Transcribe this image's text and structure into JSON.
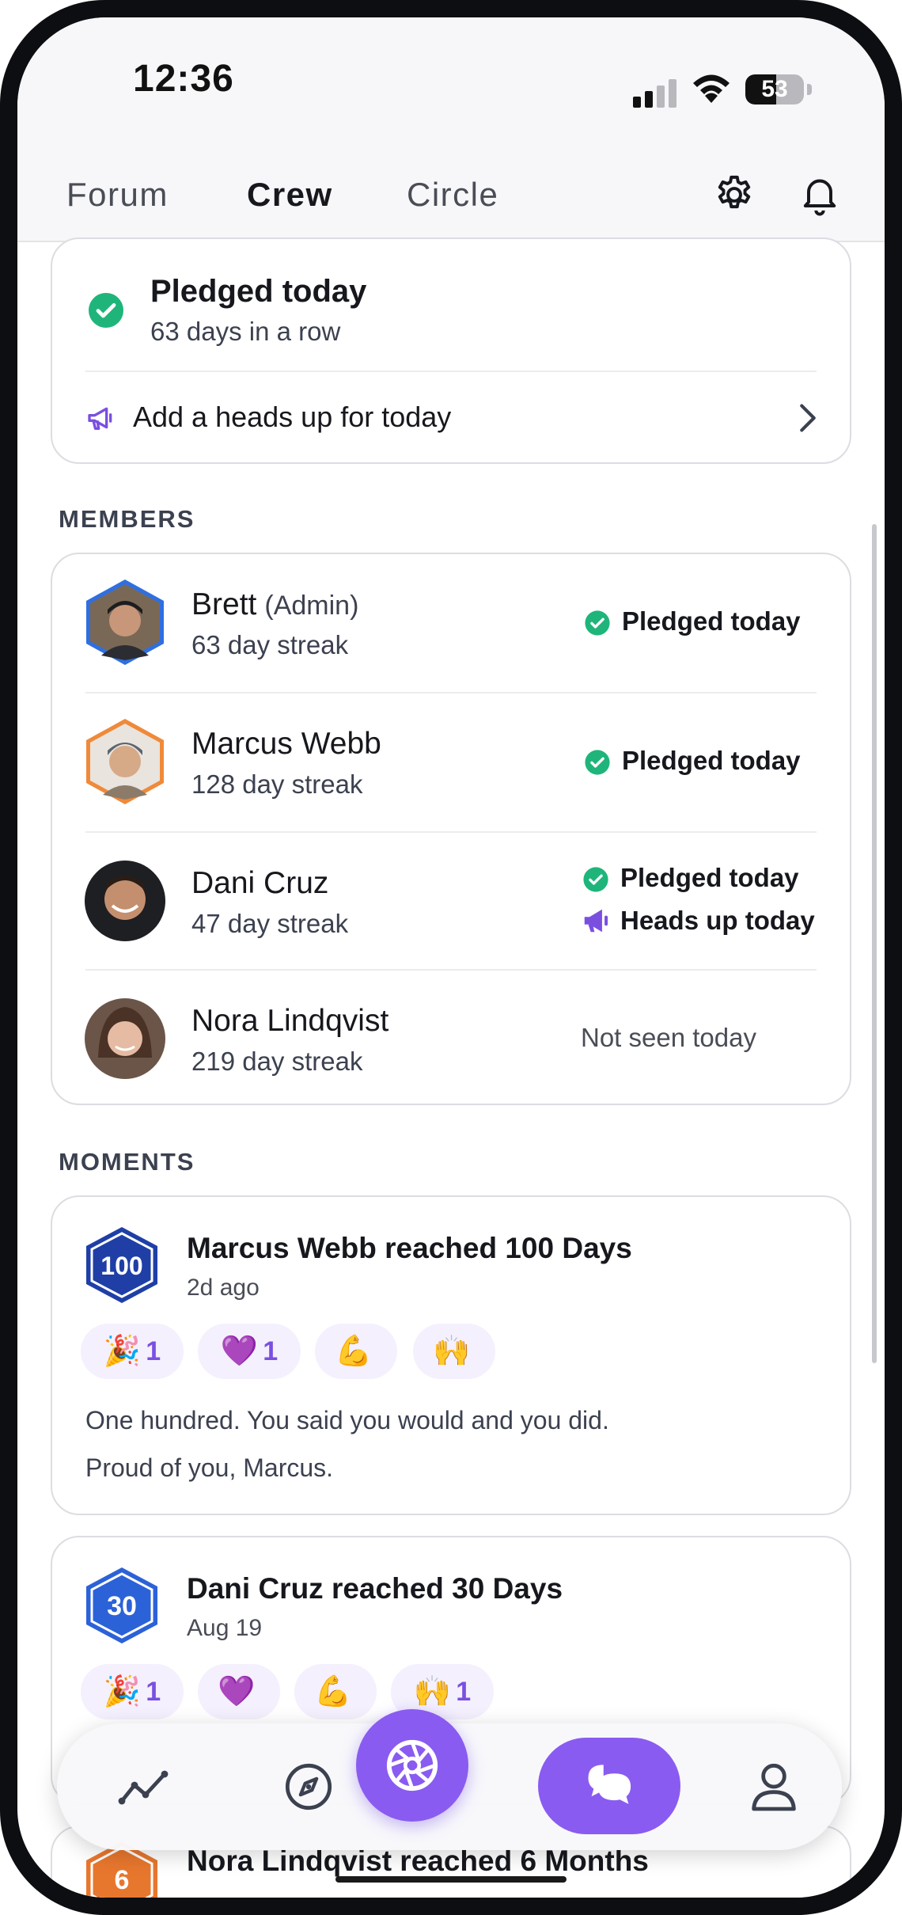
{
  "status_bar": {
    "time": "12:36",
    "battery": "53",
    "battery_level": 0.53
  },
  "tabs": [
    {
      "label": "Forum",
      "active": false
    },
    {
      "label": "Crew",
      "active": true
    },
    {
      "label": "Circle",
      "active": false
    }
  ],
  "pledge_card": {
    "title": "Pledged today",
    "subtitle": "63 days in a row",
    "heads_up_label": "Add a heads up for today"
  },
  "members_section": {
    "label": "MEMBERS",
    "members": [
      {
        "name": "Brett",
        "role": "(Admin)",
        "streak": "63 day streak",
        "status": [
          "Pledged today"
        ]
      },
      {
        "name": "Marcus Webb",
        "role": "",
        "streak": "128 day streak",
        "status": [
          "Pledged today"
        ]
      },
      {
        "name": "Dani Cruz",
        "role": "",
        "streak": "47 day streak",
        "status": [
          "Pledged today",
          "Heads up today"
        ]
      },
      {
        "name": "Nora Lindqvist",
        "role": "",
        "streak": "219 day streak",
        "status": [
          "Not seen today"
        ]
      }
    ]
  },
  "moments_section": {
    "label": "MOMENTS",
    "moments": [
      {
        "badge": "100",
        "badge_color": "#1f3fa6",
        "title": "Marcus Webb reached 100 Days",
        "time": "2d ago",
        "reactions": [
          {
            "emoji": "🎉",
            "count": "1"
          },
          {
            "emoji": "💜",
            "count": "1"
          },
          {
            "emoji": "💪",
            "count": ""
          },
          {
            "emoji": "🙌",
            "count": ""
          }
        ],
        "text": [
          "One hundred. You said you would and you did.",
          "Proud of you, Marcus."
        ]
      },
      {
        "badge": "30",
        "badge_color": "#2c62d8",
        "title": "Dani Cruz reached 30 Days",
        "time": "Aug 19",
        "reactions": [
          {
            "emoji": "🎉",
            "count": "1"
          },
          {
            "emoji": "💜",
            "count": ""
          },
          {
            "emoji": "💪",
            "count": ""
          },
          {
            "emoji": "🙌",
            "count": "1"
          }
        ],
        "text": []
      },
      {
        "badge": "6",
        "badge_color": "#e8772e",
        "title": "Nora Lindqvist reached 6 Months",
        "time": "",
        "reactions": [],
        "text": []
      }
    ]
  },
  "bottom_nav": [
    "stats-icon",
    "explore-icon",
    "camera-icon",
    "chat-icon",
    "profile-icon"
  ],
  "colors": {
    "accent": "#8a5bf0",
    "check_green": "#1fb57a",
    "heads_up_purple": "#7a4fe0"
  }
}
